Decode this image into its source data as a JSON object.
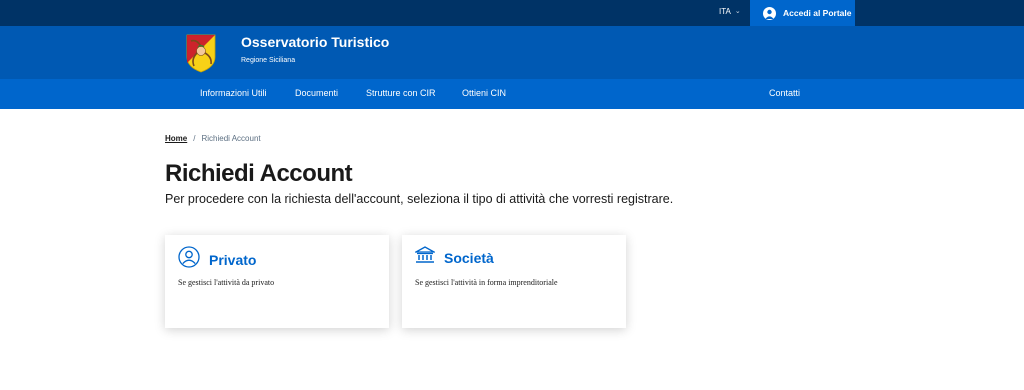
{
  "topbar": {
    "language": "ITA",
    "login_label": "Accedi al Portale"
  },
  "header": {
    "title": "Osservatorio Turistico",
    "subtitle": "Regione Siciliana"
  },
  "nav": {
    "items": [
      {
        "label": "Informazioni Utili"
      },
      {
        "label": "Documenti"
      },
      {
        "label": "Strutture con CIR"
      },
      {
        "label": "Ottieni CIN"
      }
    ],
    "contact_label": "Contatti"
  },
  "breadcrumb": {
    "home": "Home",
    "separator": "/",
    "current": "Richiedi Account"
  },
  "page": {
    "title": "Richiedi Account",
    "description": "Per procedere con la richiesta dell'account, seleziona il tipo di attività che vorresti registrare."
  },
  "cards": [
    {
      "title": "Privato",
      "text": "Se gestisci l'attività da privato",
      "icon": "user-icon"
    },
    {
      "title": "Società",
      "text": "Se gestisci l'attività in forma imprenditoriale",
      "icon": "institution-icon"
    }
  ],
  "colors": {
    "topbar": "#003366",
    "header": "#0059b3",
    "nav": "#0066cc",
    "accent": "#0066cc"
  }
}
